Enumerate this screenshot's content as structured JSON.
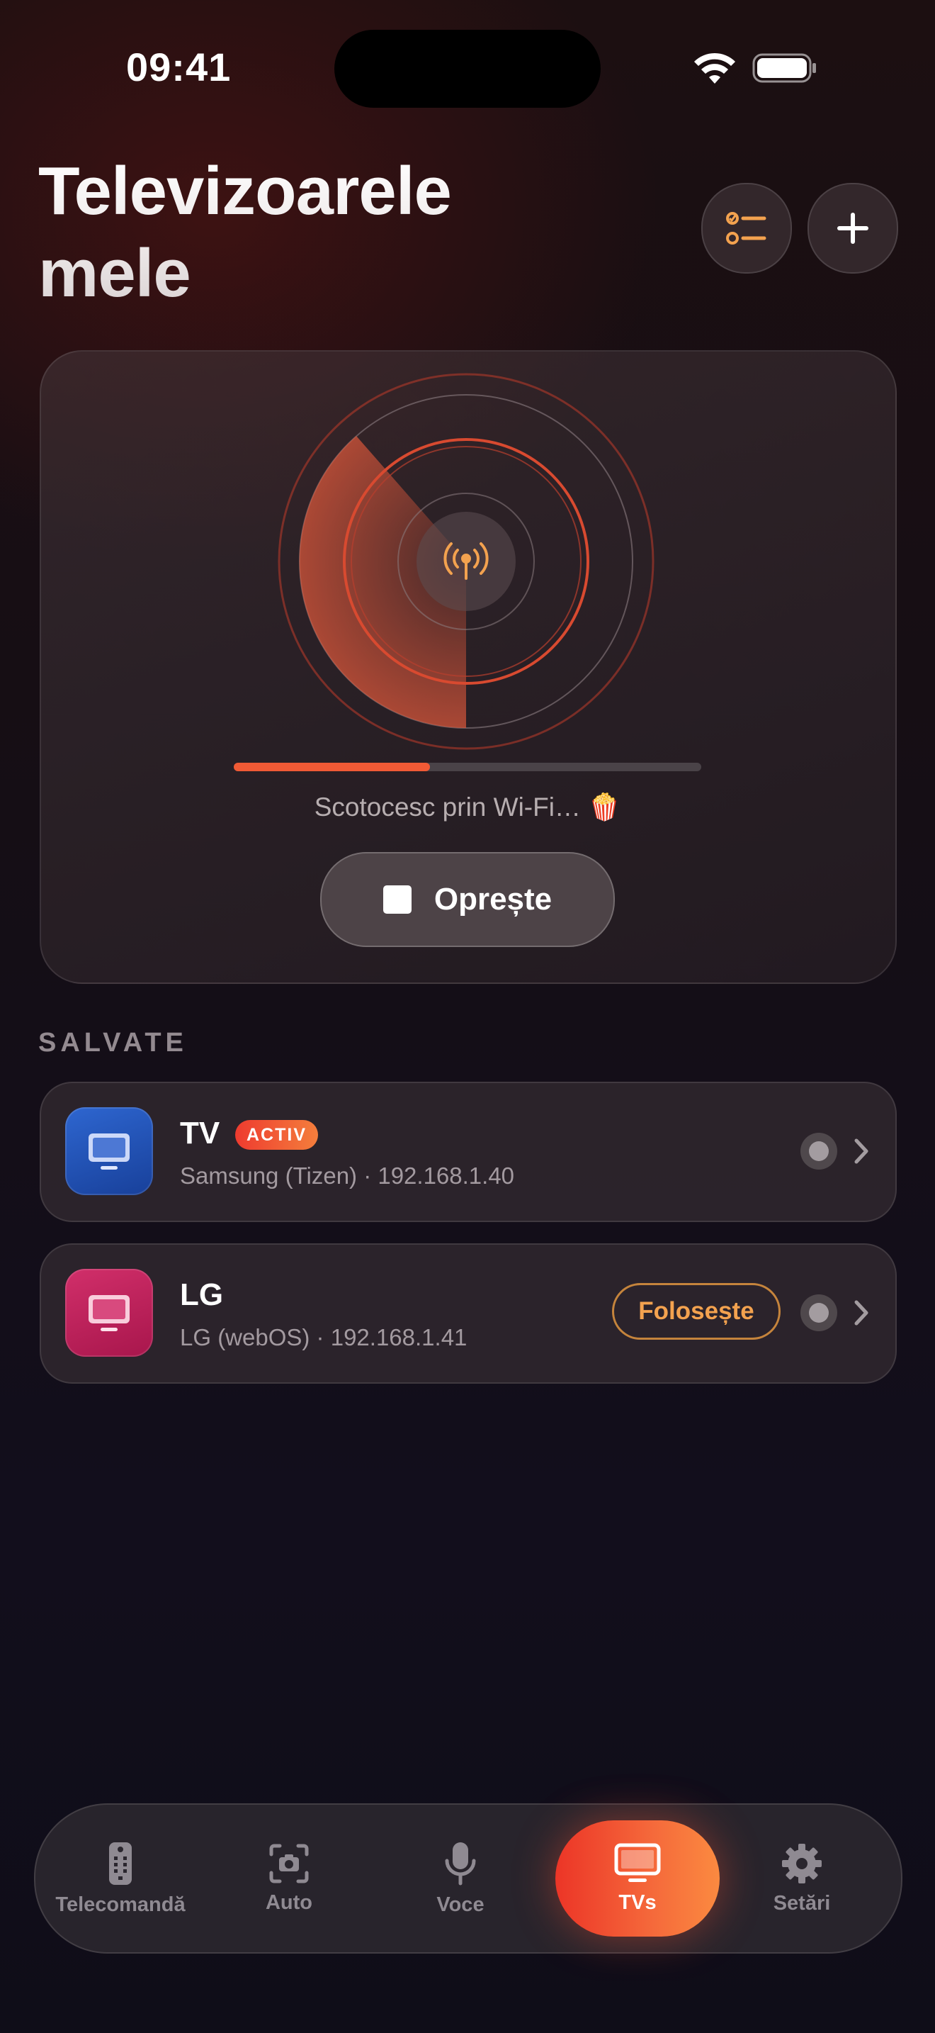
{
  "status_bar": {
    "time": "09:41"
  },
  "header": {
    "title_line1": "Televizoarele",
    "title_line2": "mele"
  },
  "scan": {
    "progress": 0.42,
    "status_text": "Scotocesc prin Wi‑Fi… 🍿",
    "stop_label": "Oprește"
  },
  "saved": {
    "section_label": "SALVATE",
    "devices": [
      {
        "name": "TV",
        "badge": "ACTIV",
        "subtitle": "Samsung (Tizen) · 192.168.1.40",
        "icon_color": "#1f4fb0"
      },
      {
        "name": "LG",
        "subtitle": "LG (webOS) · 192.168.1.41",
        "use_label": "Folosește",
        "icon_color": "#c4215c"
      }
    ]
  },
  "tabs": [
    {
      "label": "Telecomandă",
      "icon": "remote-icon"
    },
    {
      "label": "Auto",
      "icon": "camera-scan-icon"
    },
    {
      "label": "Voce",
      "icon": "microphone-icon"
    },
    {
      "label": "TVs",
      "icon": "tv-icon",
      "active": true
    },
    {
      "label": "Setări",
      "icon": "gear-icon"
    }
  ],
  "colors": {
    "accent": "#f05a35",
    "accent_orange": "#f3a24f",
    "background": "#120e1c"
  }
}
